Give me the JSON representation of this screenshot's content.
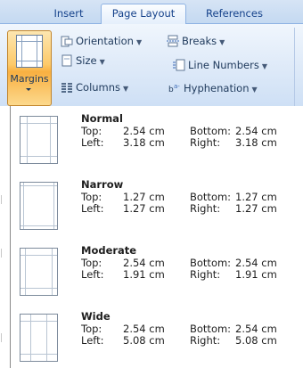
{
  "tabs": [
    {
      "label": "Insert",
      "active": false
    },
    {
      "label": "Page Layout",
      "active": true
    },
    {
      "label": "References",
      "active": false
    }
  ],
  "ribbon": {
    "margins_label": "Margins",
    "orientation_label": "Orientation",
    "size_label": "Size",
    "columns_label": "Columns",
    "breaks_label": "Breaks",
    "line_numbers_label": "Line Numbers",
    "hyphenation_label": "Hyphenation",
    "dropdown_glyph": "▼"
  },
  "margin_options": [
    {
      "name": "Normal",
      "top": "2.54 cm",
      "bottom": "2.54 cm",
      "left": "3.18 cm",
      "right": "3.18 cm"
    },
    {
      "name": "Narrow",
      "top": "1.27 cm",
      "bottom": "1.27 cm",
      "left": "1.27 cm",
      "right": "1.27 cm"
    },
    {
      "name": "Moderate",
      "top": "2.54 cm",
      "bottom": "2.54 cm",
      "left": "1.91 cm",
      "right": "1.91 cm"
    },
    {
      "name": "Wide",
      "top": "2.54 cm",
      "bottom": "2.54 cm",
      "left": "5.08 cm",
      "right": "5.08 cm"
    }
  ],
  "labels": {
    "top": "Top:",
    "bottom": "Bottom:",
    "left": "Left:",
    "right": "Right:"
  },
  "colors": {
    "accent": "#fdca6a",
    "ribbon": "#dde9f8",
    "tab_text": "#15428b"
  }
}
